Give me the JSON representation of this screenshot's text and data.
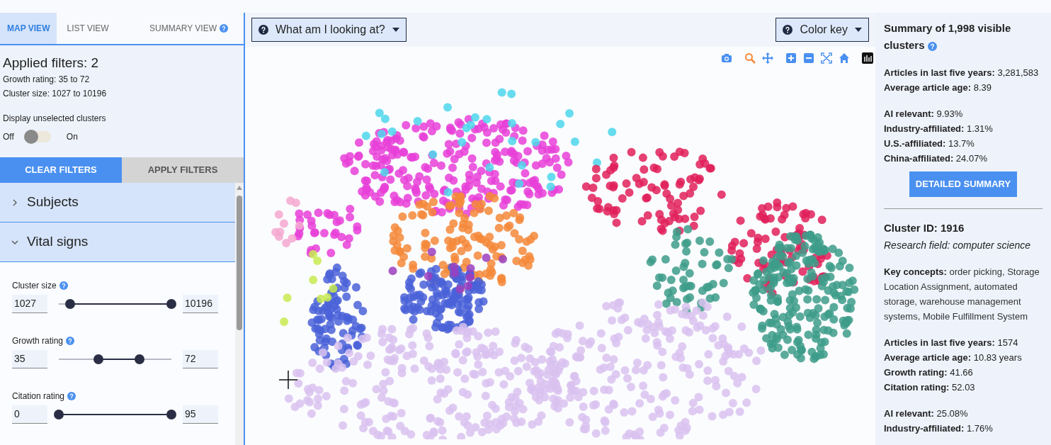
{
  "tabs": [
    {
      "label": "MAP VIEW",
      "selected": true,
      "help": false
    },
    {
      "label": "LIST VIEW",
      "selected": false,
      "help": false
    },
    {
      "label": "SUMMARY VIEW",
      "selected": false,
      "help": true
    }
  ],
  "filters": {
    "title": "Applied filters: 2",
    "lines": [
      "Growth rating: 35 to 72",
      "Cluster size: 1027 to 10196"
    ]
  },
  "display_toggle": {
    "label": "Display unselected clusters",
    "off_label": "Off",
    "on_label": "On",
    "on": false
  },
  "filter_buttons": [
    {
      "label": "CLEAR FILTERS",
      "kind": "primary"
    },
    {
      "label": "APPLY FILTERS",
      "kind": "secondary"
    }
  ],
  "sections": [
    {
      "title": "Subjects",
      "expanded": false
    },
    {
      "title": "Vital signs",
      "expanded": true
    }
  ],
  "sliders": [
    {
      "label": "Cluster size",
      "min_value": "1027",
      "max_value": "10196",
      "thumbs": [
        {
          "level": 0.1
        },
        {
          "level": 1
        }
      ]
    },
    {
      "label": "Growth rating",
      "min_value": "35",
      "max_value": "72",
      "thumbs": [
        {
          "level": 0.35
        },
        {
          "level": 0.72
        }
      ]
    },
    {
      "label": "Citation rating",
      "min_value": "0",
      "max_value": "95",
      "thumbs": [
        {
          "level": 0
        },
        {
          "level": 1
        }
      ]
    }
  ],
  "map": {
    "menus": [
      {
        "label": "What am I looking at?"
      },
      {
        "label": "Color key"
      }
    ],
    "tools": [
      {
        "kind": "camera",
        "selected": false
      },
      {
        "kind": "zoom",
        "selected": true
      },
      {
        "kind": "pan",
        "selected": false
      },
      {
        "kind": "zoom-in",
        "selected": false
      },
      {
        "kind": "zoom-out",
        "selected": false
      },
      {
        "kind": "autoscale",
        "selected": false
      },
      {
        "kind": "home",
        "selected": false
      },
      {
        "kind": "logo",
        "selected": false
      }
    ]
  },
  "summary": {
    "title": "Summary of 1,998 visible clusters",
    "groups": [
      [
        {
          "label": "Articles in last five years:",
          "value": "3,281,583"
        },
        {
          "label": "Average article age:",
          "value": "8.39"
        }
      ],
      [
        {
          "label": "AI relevant:",
          "value": "9.93%"
        },
        {
          "label": "Industry-affiliated:",
          "value": "1.31%"
        },
        {
          "label": "U.S.-affiliated:",
          "value": "13.7%"
        },
        {
          "label": "China-affiliated:",
          "value": "24.07%"
        }
      ]
    ],
    "button": "DETAILED SUMMARY"
  },
  "cluster": {
    "title": "Cluster ID: 1916",
    "field": "Research field: computer science",
    "concepts": {
      "label": "Key concepts:",
      "value": "order picking, Storage Location Assignment, automated storage, warehouse management systems, Mobile Fulfillment System"
    },
    "groups": [
      [
        {
          "label": "Articles in last five years:",
          "value": "1574"
        },
        {
          "label": "Average article age:",
          "value": "10.83 years"
        },
        {
          "label": "Growth rating:",
          "value": "41.66"
        },
        {
          "label": "Citation rating:",
          "value": "52.03"
        }
      ],
      [
        {
          "label": "AI relevant:",
          "value": "25.08%"
        },
        {
          "label": "Industry-affiliated:",
          "value": "1.76%"
        }
      ]
    ]
  }
}
